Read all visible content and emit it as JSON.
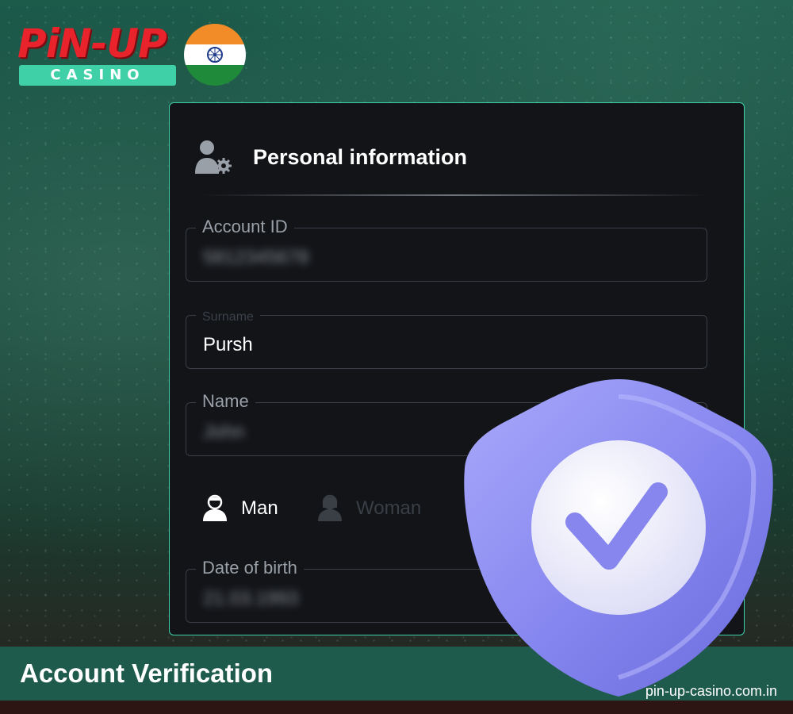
{
  "brand": {
    "logo_word": "PiN-UP",
    "logo_sub": "CASINO",
    "flag_icon": "india-flag-icon"
  },
  "card": {
    "title": "Personal information",
    "title_icon": "user-settings-icon",
    "fields": [
      {
        "label": "Account ID",
        "value": "5812345678"
      },
      {
        "label": "Surname",
        "value": "Pursh"
      },
      {
        "label": "Name",
        "value": "John"
      },
      {
        "label": "Date of birth",
        "value": "21.03.1993"
      }
    ],
    "gender": {
      "options": [
        {
          "label": "Man",
          "icon": "man-icon",
          "selected": true
        },
        {
          "label": "Woman",
          "icon": "woman-icon",
          "selected": false
        }
      ]
    }
  },
  "badge": {
    "icon": "shield-check-icon"
  },
  "banner": {
    "title": "Account Verification"
  },
  "footer": {
    "domain": "pin-up-casino.com.in"
  },
  "colors": {
    "accent": "#3fd0a8",
    "brand_red": "#e8232c",
    "card_bg": "#121418",
    "shield": "#8c8cf0"
  }
}
